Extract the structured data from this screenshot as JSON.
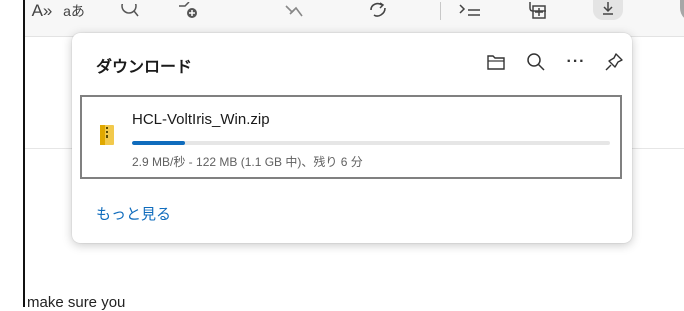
{
  "browser_toolbar": {
    "read_aloud_label": "A»",
    "read_aloud_suffix": "aあ"
  },
  "download_panel": {
    "title": "ダウンロード",
    "item": {
      "file_name": "HCL-VoltIris_Win.zip",
      "status": "2.9 MB/秒 - 122 MB (1.1 GB 中)、残り 6 分",
      "progress_fraction": 0.11
    },
    "more_link": "もっと見る",
    "icons": {
      "open_folder": "folder-icon",
      "search": "search-icon",
      "more": "more-options-icon",
      "pin": "pin-icon"
    },
    "more_glyph": "···",
    "accent_color": "#0f6cbd"
  },
  "page": {
    "visible_text": "make sure you"
  }
}
